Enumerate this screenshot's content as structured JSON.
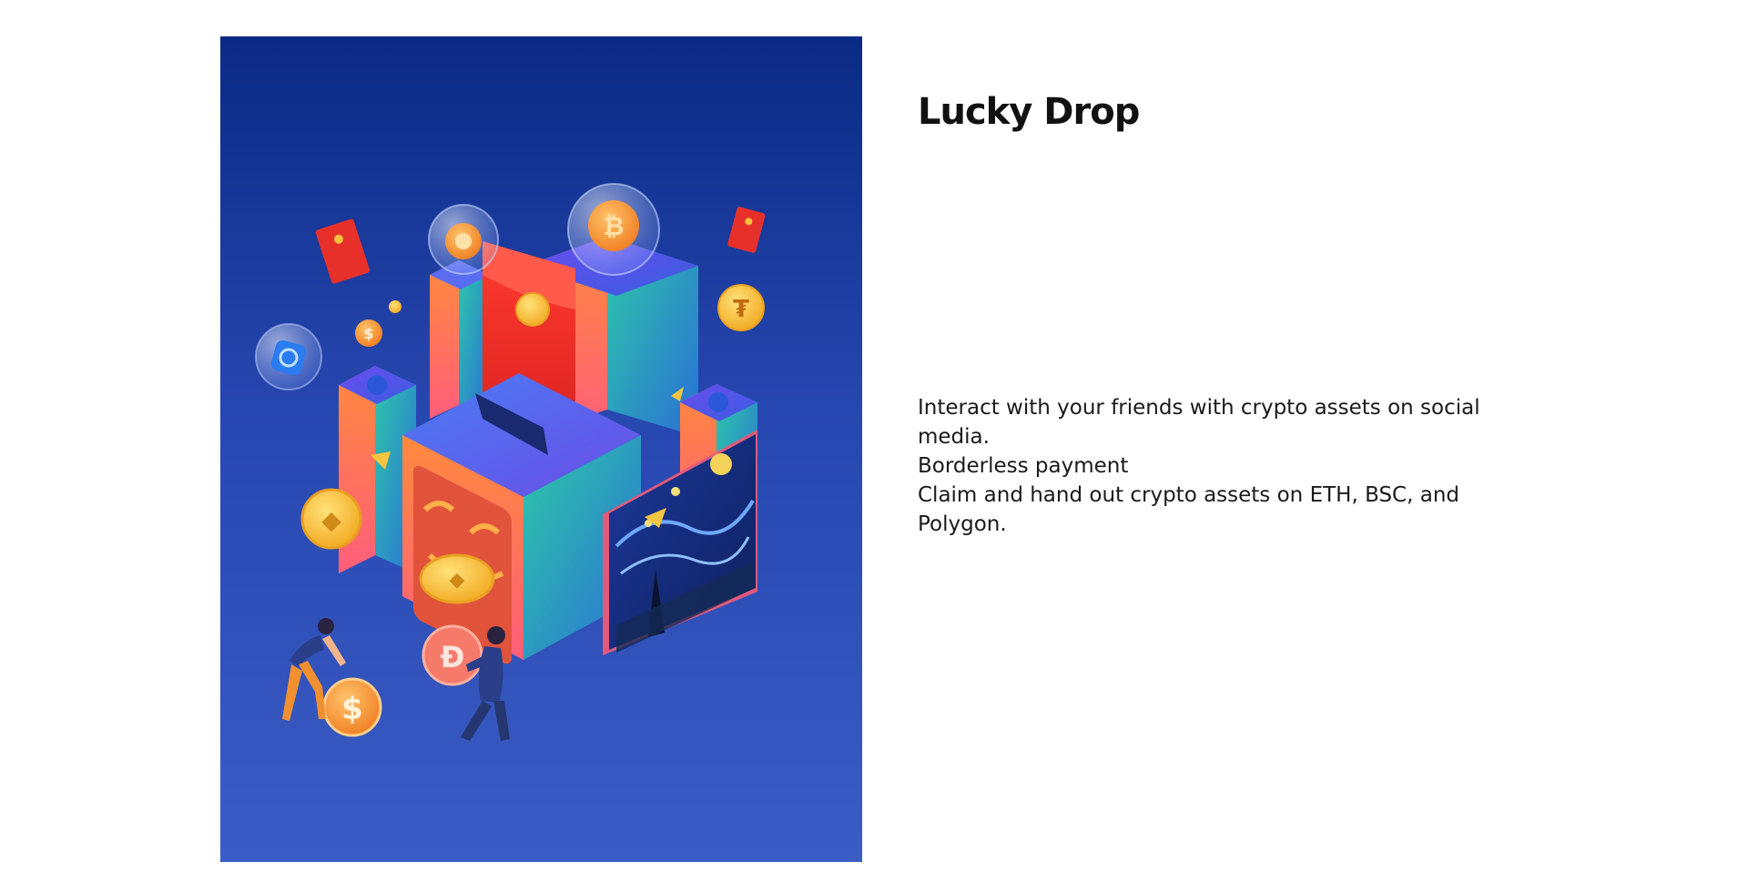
{
  "feature": {
    "title": "Lucky Drop",
    "description": [
      "Interact with your friends with crypto assets on social media.",
      "Borderless payment",
      "Claim and hand out crypto assets on ETH, BSC, and Polygon."
    ]
  },
  "illustration": {
    "coin_symbols": {
      "bitcoin": "₿",
      "tether": "₮",
      "dollar": "$",
      "dai": "Đ",
      "ethereum": "◆"
    },
    "colors": {
      "background_top": "#0a2a85",
      "background_bottom": "#3a5cc4",
      "red_packet": "#e8302b",
      "coin_gold": "#f2b81f",
      "coin_orange": "#f39a2c",
      "block_teal": "#2fb8a3",
      "block_purple": "#5b3fd0"
    }
  }
}
